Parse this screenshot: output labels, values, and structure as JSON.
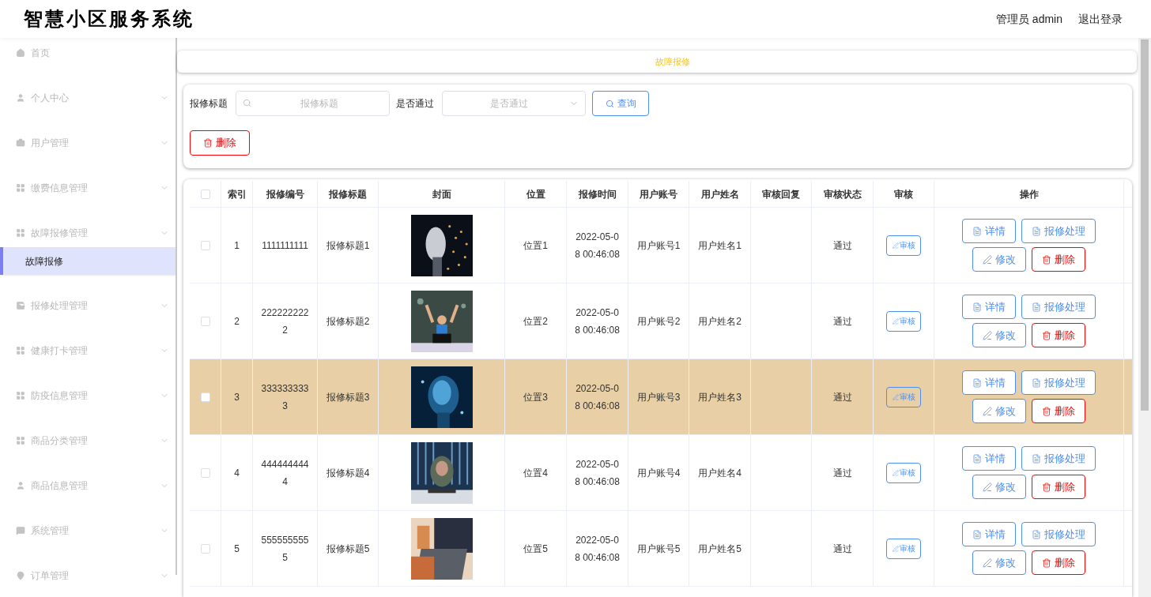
{
  "header": {
    "title": "智慧小区服务系统",
    "user": "管理员 admin",
    "logout": "退出登录"
  },
  "sidebar": {
    "items": [
      {
        "label": "首页",
        "kind": "link"
      },
      {
        "label": "个人中心",
        "kind": "group"
      },
      {
        "label": "用户管理",
        "kind": "group"
      },
      {
        "label": "缴费信息管理",
        "kind": "group"
      },
      {
        "label": "故障报修管理",
        "kind": "group",
        "children": [
          {
            "label": "故障报修",
            "selected": true
          }
        ]
      },
      {
        "label": "报修处理管理",
        "kind": "group"
      },
      {
        "label": "健康打卡管理",
        "kind": "group"
      },
      {
        "label": "防疫信息管理",
        "kind": "group"
      },
      {
        "label": "商品分类管理",
        "kind": "group"
      },
      {
        "label": "商品信息管理",
        "kind": "group"
      },
      {
        "label": "系统管理",
        "kind": "group"
      },
      {
        "label": "订单管理",
        "kind": "group"
      }
    ]
  },
  "breadcrumb": "故障报修",
  "search": {
    "fields": [
      {
        "label": "报修标题",
        "kind": "input",
        "placeholder": "报修标题"
      },
      {
        "label": "是否通过",
        "kind": "select",
        "placeholder": "是否通过"
      }
    ],
    "query_button": "查询",
    "delete_button": "删除"
  },
  "table": {
    "select_all_checked": false,
    "columns": [
      "索引",
      "报修编号",
      "报修标题",
      "封面",
      "位置",
      "报修时间",
      "用户账号",
      "用户姓名",
      "审核回复",
      "审核状态",
      "审核",
      "操作"
    ],
    "rows": [
      {
        "checked": false,
        "highlighted": false,
        "index": "1",
        "number": "1111111111",
        "title": "报修标题1",
        "cover": {
          "kind": "picture"
        },
        "location": "位置1",
        "time": "2022-05-08 00:46:08",
        "account": "用户账号1",
        "name": "用户姓名1",
        "status": "通过",
        "review": "审核",
        "actions": [
          "详情",
          "报修处理",
          "修改",
          "删除"
        ]
      },
      {
        "checked": false,
        "highlighted": false,
        "index": "2",
        "number": "2222222222",
        "title": "报修标题2",
        "cover": {
          "kind": "picture"
        },
        "location": "位置2",
        "time": "2022-05-08 00:46:08",
        "account": "用户账号2",
        "name": "用户姓名2",
        "status": "通过",
        "review": "审核",
        "actions": [
          "详情",
          "报修处理",
          "修改",
          "删除"
        ]
      },
      {
        "checked": false,
        "highlighted": true,
        "index": "3",
        "number": "3333333333",
        "title": "报修标题3",
        "cover": {
          "kind": "picture"
        },
        "location": "位置3",
        "time": "2022-05-08 00:46:08",
        "account": "用户账号3",
        "name": "用户姓名3",
        "status": "通过",
        "review": "审核",
        "actions": [
          "详情",
          "报修处理",
          "修改",
          "删除"
        ]
      },
      {
        "checked": false,
        "highlighted": false,
        "index": "4",
        "number": "4444444444",
        "title": "报修标题4",
        "cover": {
          "kind": "picture"
        },
        "location": "位置4",
        "time": "2022-05-08 00:46:08",
        "account": "用户账号4",
        "name": "用户姓名4",
        "status": "通过",
        "review": "审核",
        "actions": [
          "详情",
          "报修处理",
          "修改",
          "删除"
        ]
      },
      {
        "checked": false,
        "highlighted": false,
        "index": "5",
        "number": "5555555555",
        "title": "报修标题5",
        "cover": {
          "kind": "picture"
        },
        "location": "位置5",
        "time": "2022-05-08 00:46:08",
        "account": "用户账号5",
        "name": "用户姓名5",
        "status": "通过",
        "review": "审核",
        "actions": [
          "详情",
          "报修处理",
          "修改",
          "删除"
        ]
      }
    ]
  }
}
